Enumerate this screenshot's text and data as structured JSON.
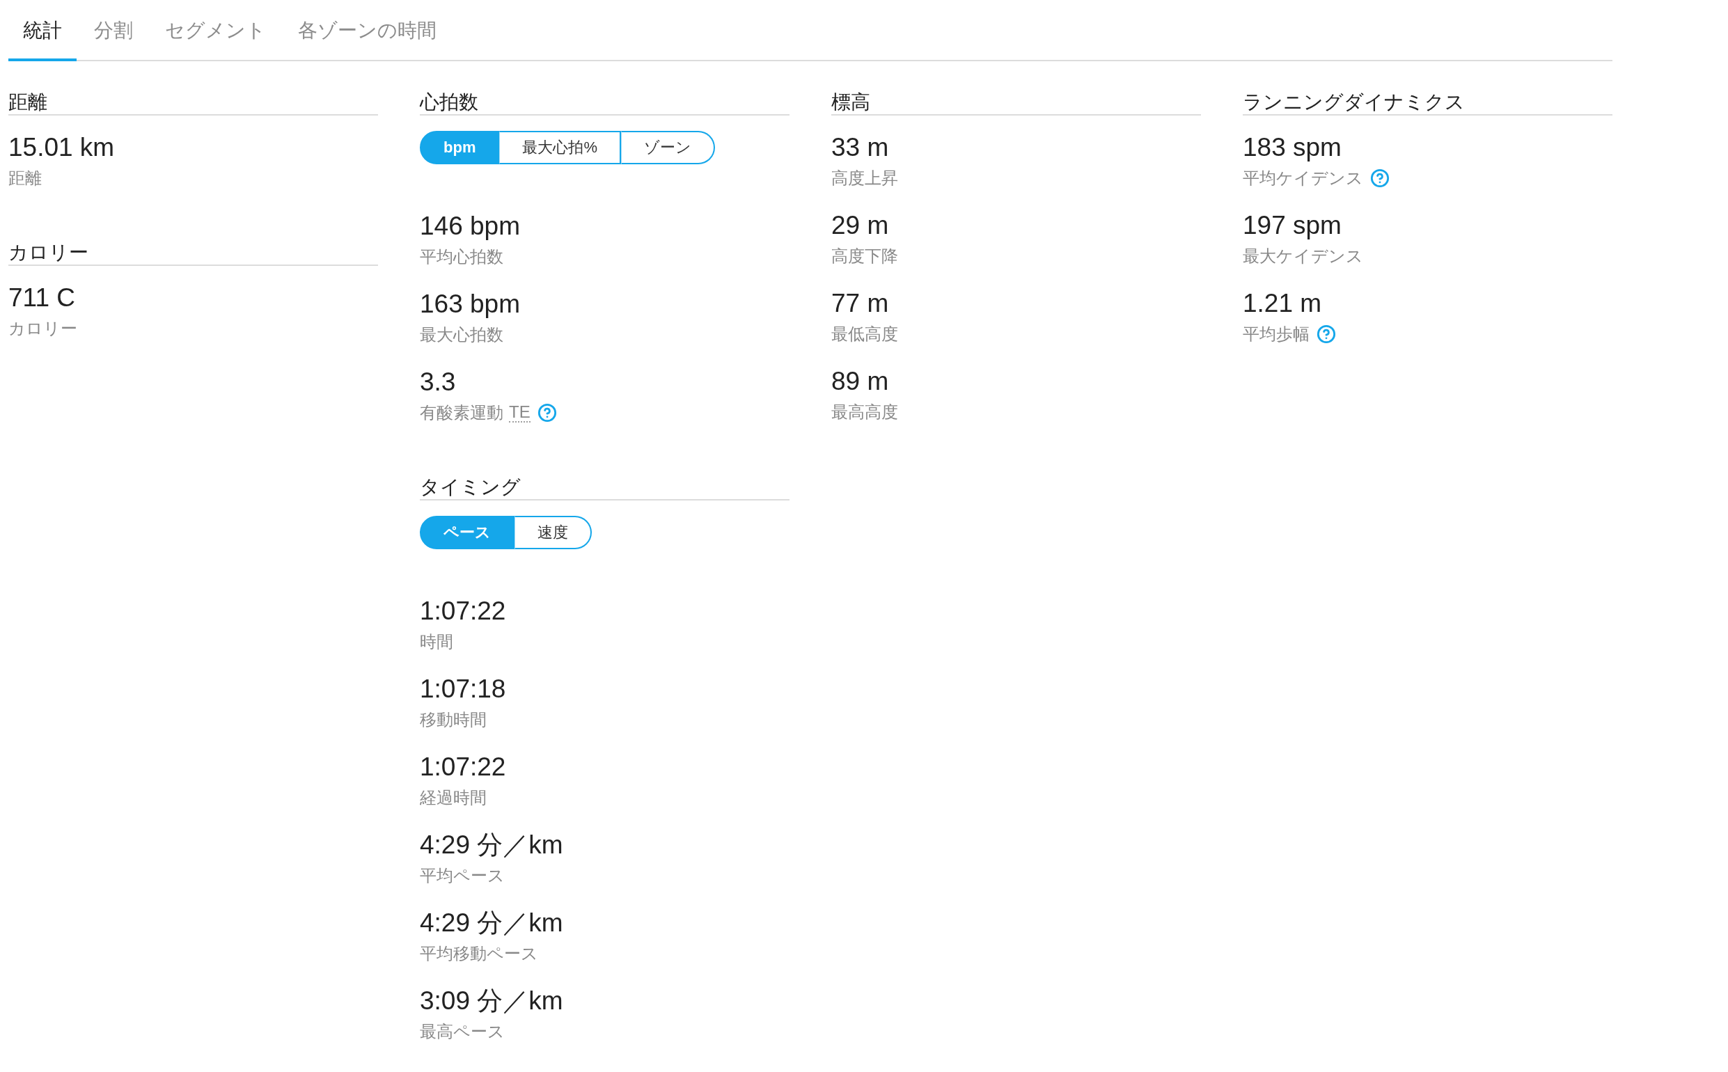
{
  "tabs": [
    {
      "label": "統計",
      "selected": true
    },
    {
      "label": "分割",
      "selected": false
    },
    {
      "label": "セグメント",
      "selected": false
    },
    {
      "label": "各ゾーンの時間",
      "selected": false
    }
  ],
  "columns": [
    {
      "sections": [
        {
          "title": "距離",
          "stats": [
            {
              "value": "15.01 km",
              "label": "距離",
              "help": false
            }
          ]
        },
        {
          "title": "カロリー",
          "stats": [
            {
              "value": "711 C",
              "label": "カロリー",
              "help": false
            }
          ]
        }
      ]
    },
    {
      "sections": [
        {
          "title": "心拍数",
          "toggle": [
            {
              "label": "bpm",
              "selected": true
            },
            {
              "label": "最大心拍%",
              "selected": false
            },
            {
              "label": "ゾーン",
              "selected": false
            }
          ],
          "stats": [
            {
              "value": "146 bpm",
              "label": "平均心拍数",
              "help": false
            },
            {
              "value": "163 bpm",
              "label": "最大心拍数",
              "help": false
            },
            {
              "value": "3.3",
              "label": "有酸素運動",
              "abbreviation": "TE",
              "help": true
            }
          ]
        },
        {
          "title": "タイミング",
          "toggle": [
            {
              "label": "ペース",
              "selected": true
            },
            {
              "label": "速度",
              "selected": false
            }
          ],
          "stats": [
            {
              "value": "1:07:22",
              "label": "時間",
              "help": false
            },
            {
              "value": "1:07:18",
              "label": "移動時間",
              "help": false
            },
            {
              "value": "1:07:22",
              "label": "経過時間",
              "help": false
            },
            {
              "value": "4:29 分／km",
              "label": "平均ペース",
              "help": false
            },
            {
              "value": "4:29 分／km",
              "label": "平均移動ペース",
              "help": false
            },
            {
              "value": "3:09 分／km",
              "label": "最高ペース",
              "help": false
            }
          ]
        }
      ]
    },
    {
      "sections": [
        {
          "title": "標高",
          "stats": [
            {
              "value": "33 m",
              "label": "高度上昇",
              "help": false
            },
            {
              "value": "29 m",
              "label": "高度下降",
              "help": false
            },
            {
              "value": "77 m",
              "label": "最低高度",
              "help": false
            },
            {
              "value": "89 m",
              "label": "最高高度",
              "help": false
            }
          ]
        }
      ]
    },
    {
      "sections": [
        {
          "title": "ランニングダイナミクス",
          "stats": [
            {
              "value": "183 spm",
              "label": "平均ケイデンス",
              "help": true
            },
            {
              "value": "197 spm",
              "label": "最大ケイデンス",
              "help": false
            },
            {
              "value": "1.21 m",
              "label": "平均歩幅",
              "help": true
            }
          ]
        }
      ]
    }
  ]
}
